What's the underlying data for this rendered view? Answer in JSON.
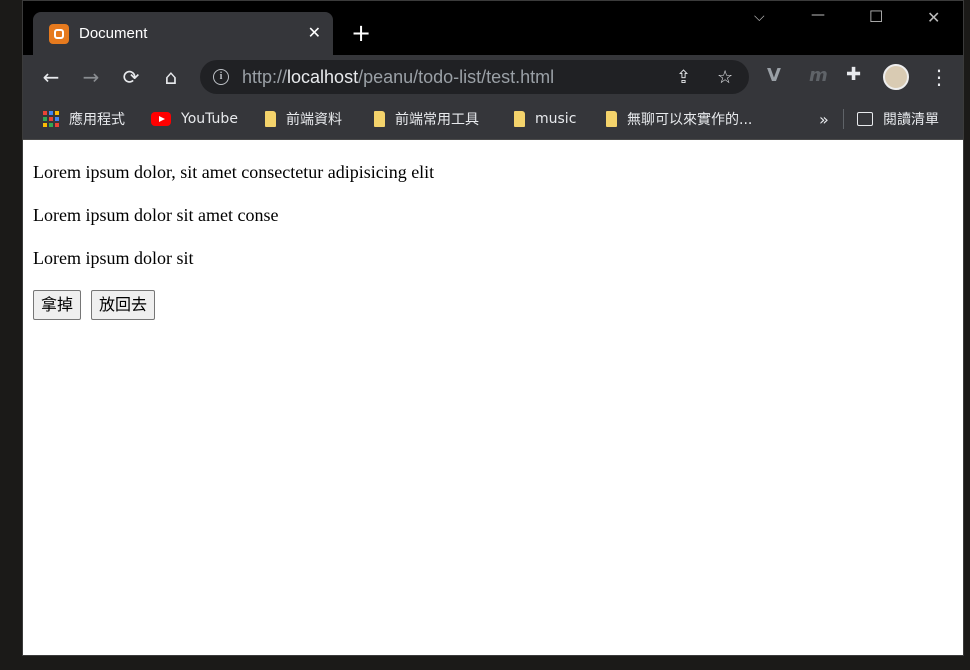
{
  "tab": {
    "title": "Document",
    "close": "✕"
  },
  "new_tab": "+",
  "window_controls": {
    "dropdown": "⌵",
    "minimize": "—",
    "maximize": "☐",
    "close": "✕"
  },
  "toolbar": {
    "back": "←",
    "forward": "→",
    "reload": "⟳",
    "home": "⌂",
    "url_scheme": "http://",
    "url_host": "localhost",
    "url_path": "/peanu/todo-list/test.html",
    "share": "⇪",
    "star": "☆",
    "ext1": "V",
    "ext2": "m",
    "extensions": "✚",
    "menu": "⋮"
  },
  "bookmarks": {
    "items": [
      {
        "label": "應用程式",
        "icon": "apps-icon"
      },
      {
        "label": "YouTube",
        "icon": "youtube-icon"
      },
      {
        "label": "前端資料",
        "icon": "folder-icon"
      },
      {
        "label": "前端常用工具",
        "icon": "folder-icon"
      },
      {
        "label": "music",
        "icon": "folder-icon"
      },
      {
        "label": "無聊可以來實作的...",
        "icon": "folder-icon"
      }
    ],
    "more": "»",
    "reading_list": "閱讀清單"
  },
  "page": {
    "lines": [
      "Lorem ipsum dolor, sit amet consectetur adipisicing elit",
      "Lorem ipsum dolor sit amet conse",
      "Lorem ipsum dolor sit"
    ],
    "remove_button": "拿掉",
    "restore_button": "放回去"
  },
  "colors": {
    "chrome_dark": "#35363a",
    "favicon": "#e67a1e",
    "folder": "#f4d36b",
    "youtube": "#ff0000"
  }
}
